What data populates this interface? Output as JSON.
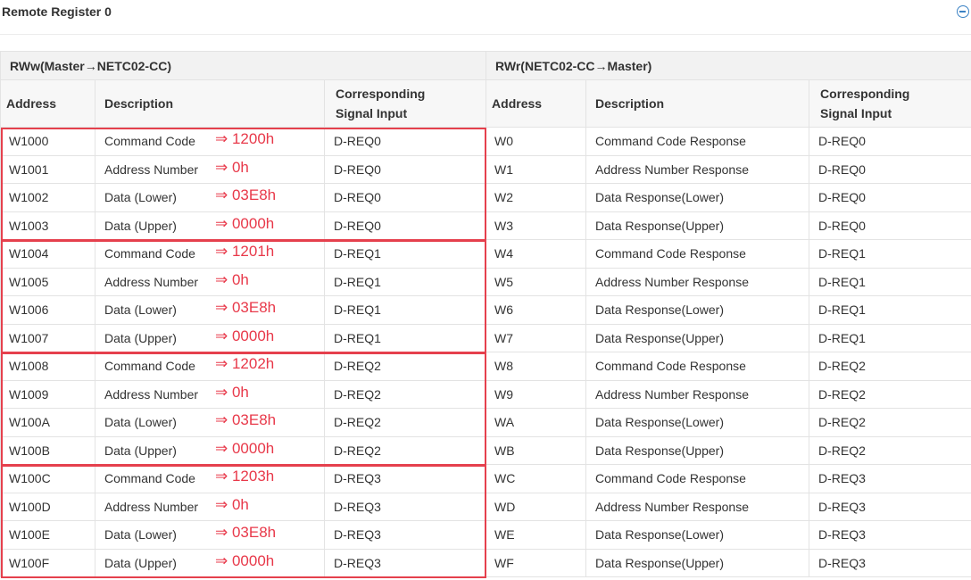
{
  "page": {
    "title": "Remote Register 0"
  },
  "table": {
    "left_group": "RWw(Master→NETC02-CC)",
    "right_group": "RWr(NETC02-CC→Master)",
    "headers": {
      "address": "Address",
      "description": "Description",
      "signal_line1": "Corresponding",
      "signal_line2": "Signal Input"
    },
    "rows": [
      {
        "waddr": "W1000",
        "wdesc": "Command Code",
        "note": "⇒ 1200h",
        "wsig": "D-REQ0",
        "raddr": "W0",
        "rdesc": "Command Code Response",
        "rsig": "D-REQ0"
      },
      {
        "waddr": "W1001",
        "wdesc": "Address Number",
        "note": "⇒ 0h",
        "wsig": "D-REQ0",
        "raddr": "W1",
        "rdesc": "Address Number Response",
        "rsig": "D-REQ0"
      },
      {
        "waddr": "W1002",
        "wdesc": "Data (Lower)",
        "note": "⇒ 03E8h",
        "wsig": "D-REQ0",
        "raddr": "W2",
        "rdesc": "Data Response(Lower)",
        "rsig": "D-REQ0"
      },
      {
        "waddr": "W1003",
        "wdesc": "Data (Upper)",
        "note": "⇒ 0000h",
        "wsig": "D-REQ0",
        "raddr": "W3",
        "rdesc": "Data Response(Upper)",
        "rsig": "D-REQ0"
      },
      {
        "waddr": "W1004",
        "wdesc": "Command Code",
        "note": "⇒ 1201h",
        "wsig": "D-REQ1",
        "raddr": "W4",
        "rdesc": "Command Code Response",
        "rsig": "D-REQ1"
      },
      {
        "waddr": "W1005",
        "wdesc": "Address Number",
        "note": "⇒ 0h",
        "wsig": "D-REQ1",
        "raddr": "W5",
        "rdesc": "Address Number Response",
        "rsig": "D-REQ1"
      },
      {
        "waddr": "W1006",
        "wdesc": "Data (Lower)",
        "note": "⇒ 03E8h",
        "wsig": "D-REQ1",
        "raddr": "W6",
        "rdesc": "Data Response(Lower)",
        "rsig": "D-REQ1"
      },
      {
        "waddr": "W1007",
        "wdesc": "Data (Upper)",
        "note": "⇒ 0000h",
        "wsig": "D-REQ1",
        "raddr": "W7",
        "rdesc": "Data Response(Upper)",
        "rsig": "D-REQ1"
      },
      {
        "waddr": "W1008",
        "wdesc": "Command Code",
        "note": "⇒ 1202h",
        "wsig": "D-REQ2",
        "raddr": "W8",
        "rdesc": "Command Code Response",
        "rsig": "D-REQ2"
      },
      {
        "waddr": "W1009",
        "wdesc": "Address Number",
        "note": "⇒ 0h",
        "wsig": "D-REQ2",
        "raddr": "W9",
        "rdesc": "Address Number Response",
        "rsig": "D-REQ2"
      },
      {
        "waddr": "W100A",
        "wdesc": "Data (Lower)",
        "note": "⇒ 03E8h",
        "wsig": "D-REQ2",
        "raddr": "WA",
        "rdesc": "Data Response(Lower)",
        "rsig": "D-REQ2"
      },
      {
        "waddr": "W100B",
        "wdesc": "Data (Upper)",
        "note": "⇒ 0000h",
        "wsig": "D-REQ2",
        "raddr": "WB",
        "rdesc": "Data Response(Upper)",
        "rsig": "D-REQ2"
      },
      {
        "waddr": "W100C",
        "wdesc": "Command Code",
        "note": "⇒ 1203h",
        "wsig": "D-REQ3",
        "raddr": "WC",
        "rdesc": "Command Code Response",
        "rsig": "D-REQ3"
      },
      {
        "waddr": "W100D",
        "wdesc": "Address Number",
        "note": "⇒ 0h",
        "wsig": "D-REQ3",
        "raddr": "WD",
        "rdesc": "Address Number Response",
        "rsig": "D-REQ3"
      },
      {
        "waddr": "W100E",
        "wdesc": "Data (Lower)",
        "note": "⇒ 03E8h",
        "wsig": "D-REQ3",
        "raddr": "WE",
        "rdesc": "Data Response(Lower)",
        "rsig": "D-REQ3"
      },
      {
        "waddr": "W100F",
        "wdesc": "Data (Upper)",
        "note": "⇒ 0000h",
        "wsig": "D-REQ3",
        "raddr": "WF",
        "rdesc": "Data Response(Upper)",
        "rsig": "D-REQ3"
      }
    ]
  },
  "annotation": {
    "color": "#e5404d",
    "groups": 4
  },
  "colors": {
    "header_bg": "#f7f7f7",
    "group_bg": "#f2f2f2",
    "accent": "#3b82c4"
  },
  "icons": {
    "collapse": "minus-circle-icon"
  }
}
